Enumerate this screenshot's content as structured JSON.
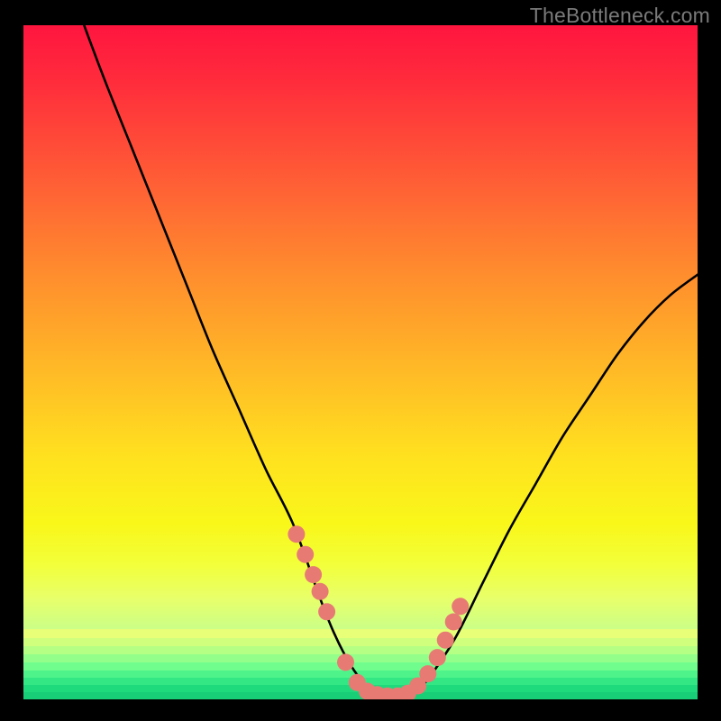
{
  "watermark": "TheBottleneck.com",
  "colors": {
    "frame": "#000000",
    "curve": "#000000",
    "marker_fill": "#e77b74",
    "marker_stroke": "#d96a63"
  },
  "chart_data": {
    "type": "line",
    "title": "",
    "xlabel": "",
    "ylabel": "",
    "xlim": [
      0,
      100
    ],
    "ylim": [
      0,
      100
    ],
    "grid": false,
    "note": "Axes unlabeled; values are percentage positions read from the plot area (0,0 = bottom-left).",
    "series": [
      {
        "name": "bottleneck-curve",
        "x": [
          9,
          12,
          16,
          20,
          24,
          28,
          32,
          36,
          40,
          44,
          46,
          48,
          50,
          52,
          54,
          56,
          58,
          60,
          64,
          68,
          72,
          76,
          80,
          84,
          88,
          92,
          96,
          100
        ],
        "y": [
          100,
          92,
          82,
          72,
          62,
          52,
          43,
          34,
          26,
          15,
          10,
          6,
          3,
          1,
          0.5,
          0.5,
          1,
          3,
          9,
          17,
          25,
          32,
          39,
          45,
          51,
          56,
          60,
          63
        ]
      }
    ],
    "markers": {
      "name": "highlighted-points",
      "x": [
        40.5,
        41.8,
        43.0,
        44.0,
        45.0,
        47.8,
        49.5,
        51.0,
        52.5,
        54.0,
        55.5,
        57.0,
        58.5,
        60.0,
        61.4,
        62.6,
        63.8,
        64.8
      ],
      "y": [
        24.5,
        21.5,
        18.5,
        16.0,
        13.0,
        5.5,
        2.5,
        1.2,
        0.7,
        0.5,
        0.5,
        0.9,
        2.0,
        3.8,
        6.2,
        8.8,
        11.5,
        13.8
      ]
    },
    "background_gradient": {
      "stops": [
        {
          "pos": 0.0,
          "color": "#ff153f"
        },
        {
          "pos": 0.22,
          "color": "#ff5a36"
        },
        {
          "pos": 0.5,
          "color": "#ffb627"
        },
        {
          "pos": 0.74,
          "color": "#f9f71a"
        },
        {
          "pos": 0.9,
          "color": "#c8ff8a"
        },
        {
          "pos": 1.0,
          "color": "#1be078"
        }
      ]
    }
  }
}
